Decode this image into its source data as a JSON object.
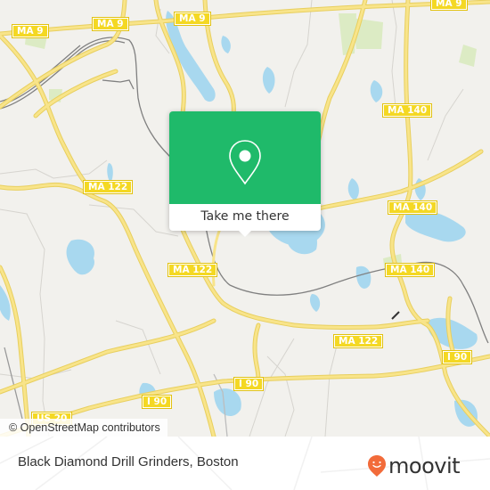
{
  "map": {
    "road_labels": [
      {
        "id": "ma9-west",
        "text": "MA 9"
      },
      {
        "id": "ma9-center",
        "text": "MA 9"
      },
      {
        "id": "ma9-east1",
        "text": "MA 9"
      },
      {
        "id": "ma9-east2",
        "text": "MA 9"
      },
      {
        "id": "ma140-north",
        "text": "MA 140"
      },
      {
        "id": "ma122-west",
        "text": "MA 122"
      },
      {
        "id": "ma140-mid",
        "text": "MA 140"
      },
      {
        "id": "ma122-center",
        "text": "MA 122"
      },
      {
        "id": "ma140-south",
        "text": "MA 140"
      },
      {
        "id": "ma122-south",
        "text": "MA 122"
      },
      {
        "id": "i90-east",
        "text": "I 90"
      },
      {
        "id": "i90-center",
        "text": "I 90"
      },
      {
        "id": "i90-west",
        "text": "I 90"
      },
      {
        "id": "us20",
        "text": "US 20"
      }
    ],
    "attribution": "© OpenStreetMap contributors",
    "colors": {
      "land": "#f2f1ed",
      "water": "#a8d8ef",
      "road": "#f6e07a",
      "park": "#d9ebc0",
      "rail": "#777777"
    }
  },
  "popup": {
    "action_label": "Take me there",
    "icon": "location-pin-icon",
    "color": "#1fba6a"
  },
  "footer": {
    "place_name": "Black Diamond Drill Grinders, Boston",
    "brand": "moovit",
    "brand_color": "#f26b3a"
  }
}
